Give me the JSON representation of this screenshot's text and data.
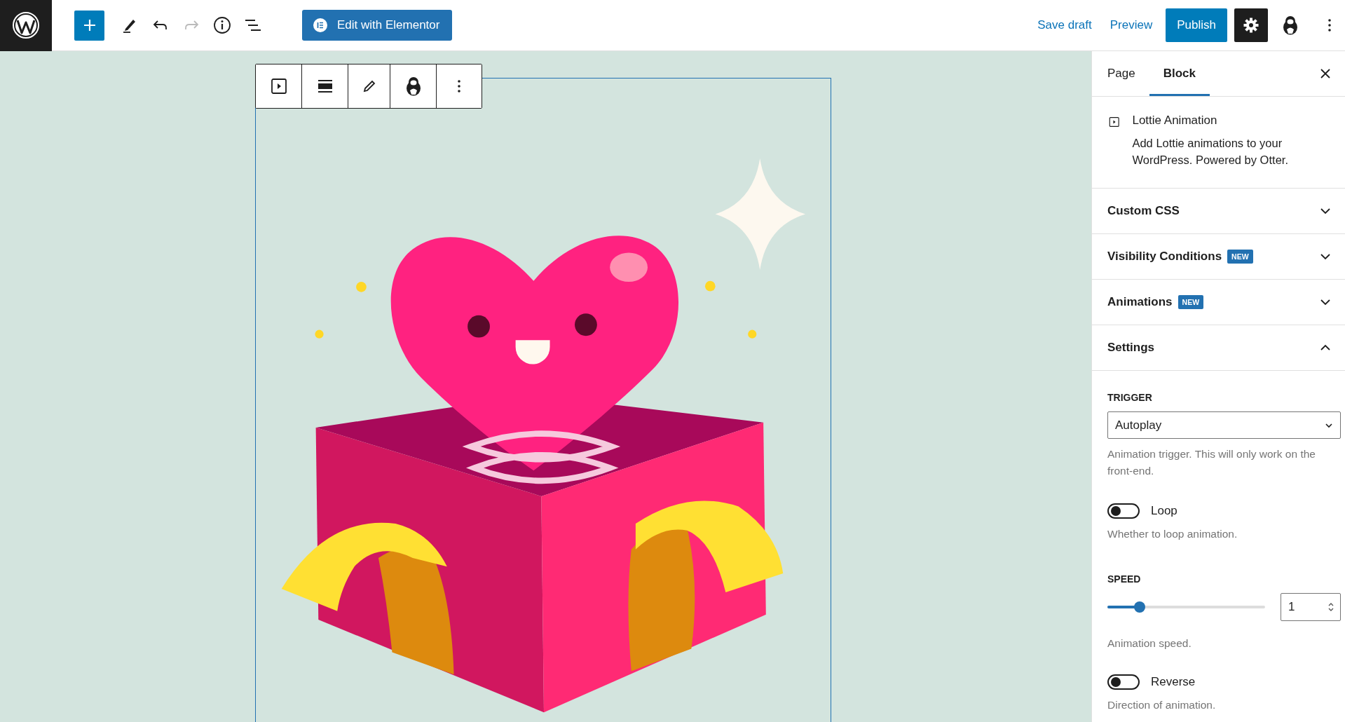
{
  "topbar": {
    "elementor_button": "Edit with Elementor",
    "save_draft": "Save draft",
    "preview": "Preview",
    "publish": "Publish",
    "settings_active": true
  },
  "sidebar": {
    "tabs": [
      {
        "label": "Page",
        "selected": false
      },
      {
        "label": "Block",
        "selected": true
      }
    ],
    "block_card": {
      "title": "Lottie Animation",
      "description": "Add Lottie animations to your WordPress. Powered by Otter."
    },
    "panels": [
      {
        "title": "Custom CSS",
        "expanded": false
      },
      {
        "title": "Visibility Conditions",
        "badge": "NEW",
        "expanded": false
      },
      {
        "title": "Animations",
        "badge": "NEW",
        "expanded": false
      },
      {
        "title": "Settings",
        "expanded": true
      }
    ],
    "settings": [
      {
        "kind": "select",
        "label": "TRIGGER",
        "value": "Autoplay",
        "help": "Animation trigger. This will only work on the front-end."
      },
      {
        "kind": "toggle",
        "label": "Loop",
        "on": false,
        "help": "Whether to loop animation."
      },
      {
        "kind": "slider",
        "label": "SPEED",
        "level": 0.18,
        "value": "1",
        "help": "Animation speed."
      },
      {
        "kind": "toggle",
        "label": "Reverse",
        "on": false,
        "help": "Direction of animation."
      }
    ]
  }
}
